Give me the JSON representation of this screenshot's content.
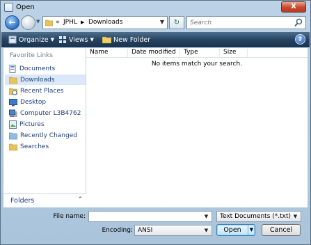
{
  "window": {
    "title": "Open",
    "close_label": "X"
  },
  "nav": {
    "breadcrumb_prefix": "«",
    "breadcrumbs": [
      "JPHL",
      "Downloads"
    ],
    "search_placeholder": "Search"
  },
  "toolbar": {
    "organize": "Organize",
    "views": "Views",
    "new_folder": "New Folder",
    "help": "?"
  },
  "sidebar": {
    "header": "Favorite Links",
    "items": [
      {
        "label": "Documents",
        "icon": "documents-icon"
      },
      {
        "label": "Downloads",
        "icon": "downloads-folder-icon"
      },
      {
        "label": "Recent Places",
        "icon": "recent-places-icon"
      },
      {
        "label": "Desktop",
        "icon": "desktop-icon"
      },
      {
        "label": "Computer L3B4762",
        "icon": "computer-icon"
      },
      {
        "label": "Pictures",
        "icon": "pictures-icon"
      },
      {
        "label": "Recently Changed",
        "icon": "recently-changed-icon"
      },
      {
        "label": "Searches",
        "icon": "searches-folder-icon"
      }
    ],
    "folders_label": "Folders"
  },
  "file_list": {
    "columns": [
      "Name",
      "Date modified",
      "Type",
      "Size"
    ],
    "empty_message": "No items match your search."
  },
  "footer": {
    "file_name_label": "File name:",
    "file_name_value": "",
    "file_type_value": "Text Documents (*.txt)",
    "encoding_label": "Encoding:",
    "encoding_value": "ANSI",
    "open_label": "Open",
    "cancel_label": "Cancel"
  },
  "colors": {
    "toolbar_bg": "#26435f",
    "link_text": "#1d3f7a",
    "selected_item_bg": "#dbe8f7"
  }
}
